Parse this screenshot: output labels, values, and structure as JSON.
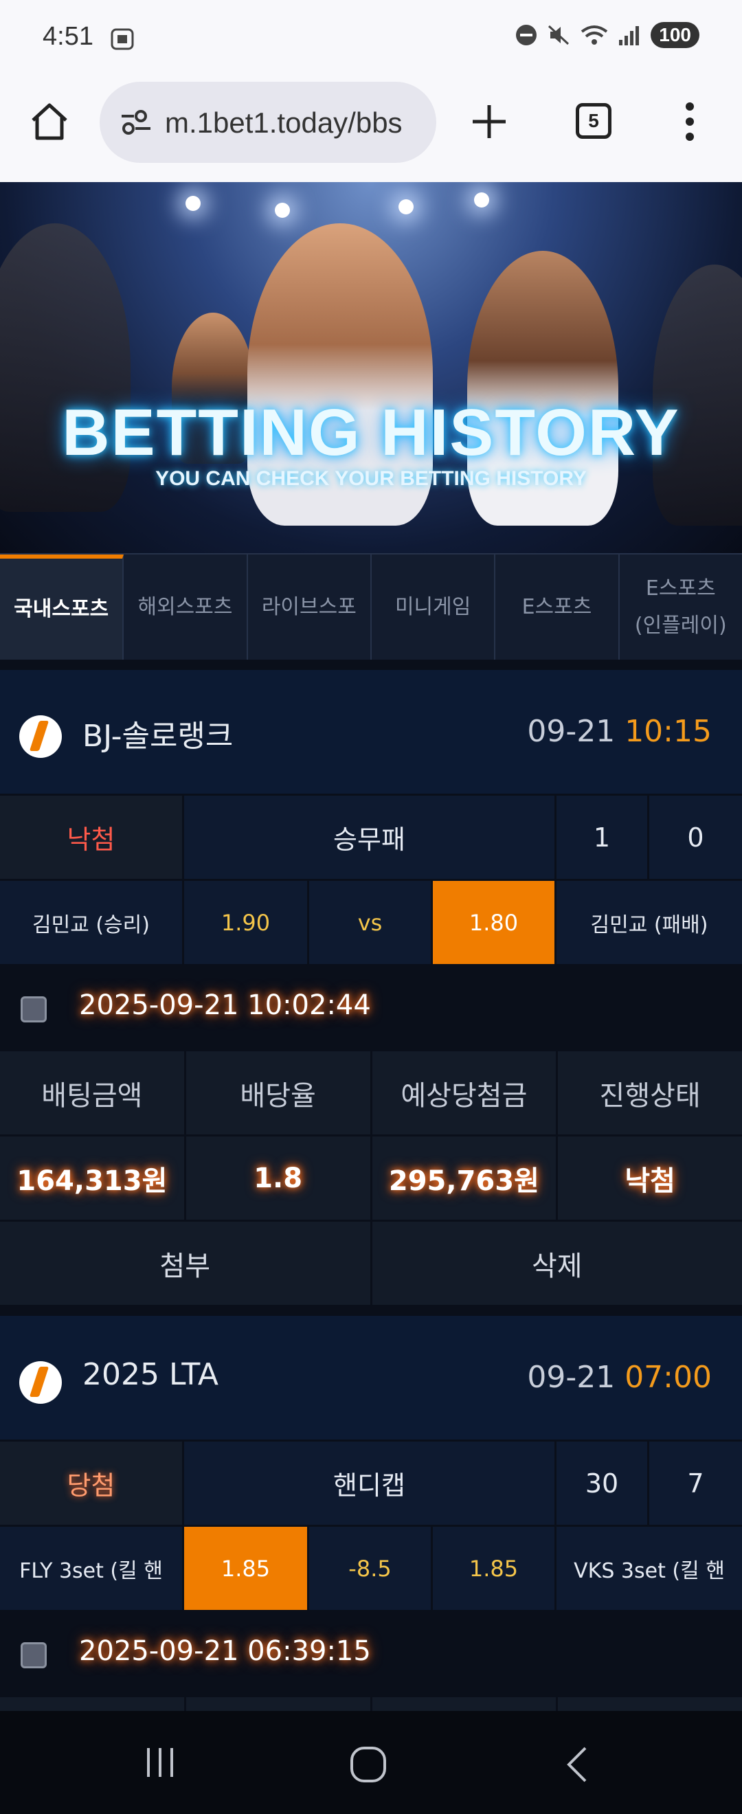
{
  "status_bar": {
    "time": "4:51",
    "battery": "100"
  },
  "browser": {
    "url": "m.1bet1.today/bbs",
    "tab_count": "5"
  },
  "banner": {
    "title": "BETTING HISTORY",
    "subtitle": "YOU CAN CHECK YOUR BETTING HISTORY"
  },
  "tabs": [
    {
      "label": "국내스포츠"
    },
    {
      "label": "해외스포츠"
    },
    {
      "label": "라이브스포"
    },
    {
      "label": "미니게임"
    },
    {
      "label": "E스포츠"
    },
    {
      "label_line1": "E스포츠",
      "label_line2": "(인플레이)"
    }
  ],
  "bets": [
    {
      "league": "BJ-솔로랭크",
      "date": "09-21",
      "time": "10:15",
      "result": "낙첨",
      "market": "승무패",
      "score_home": "1",
      "score_away": "0",
      "home_team": "김민교 (승리)",
      "home_odd": "1.90",
      "mid": "vs",
      "away_odd": "1.80",
      "away_team": "김민교 (패배)",
      "bet_datetime": "2025-09-21 10:02:44",
      "headers": [
        "배팅금액",
        "배당율",
        "예상당첨금",
        "진행상태"
      ],
      "values": [
        "164,313원",
        "1.8",
        "295,763원",
        "낙첨"
      ],
      "actions": [
        "첨부",
        "삭제"
      ]
    },
    {
      "league": "2025 LTA",
      "date": "09-21",
      "time": "07:00",
      "result": "당첨",
      "market": "핸디캡",
      "score_home": "30",
      "score_away": "7",
      "home_team": "FLY 3set (킬 핸",
      "home_odd": "1.85",
      "mid": "-8.5",
      "away_odd": "1.85",
      "away_team": "VKS 3set (킬 핸",
      "bet_datetime": "2025-09-21 06:39:15"
    }
  ],
  "colors": {
    "accent": "#f07d00",
    "card_bg": "#0e1a30",
    "glow": "#ff5a00"
  }
}
